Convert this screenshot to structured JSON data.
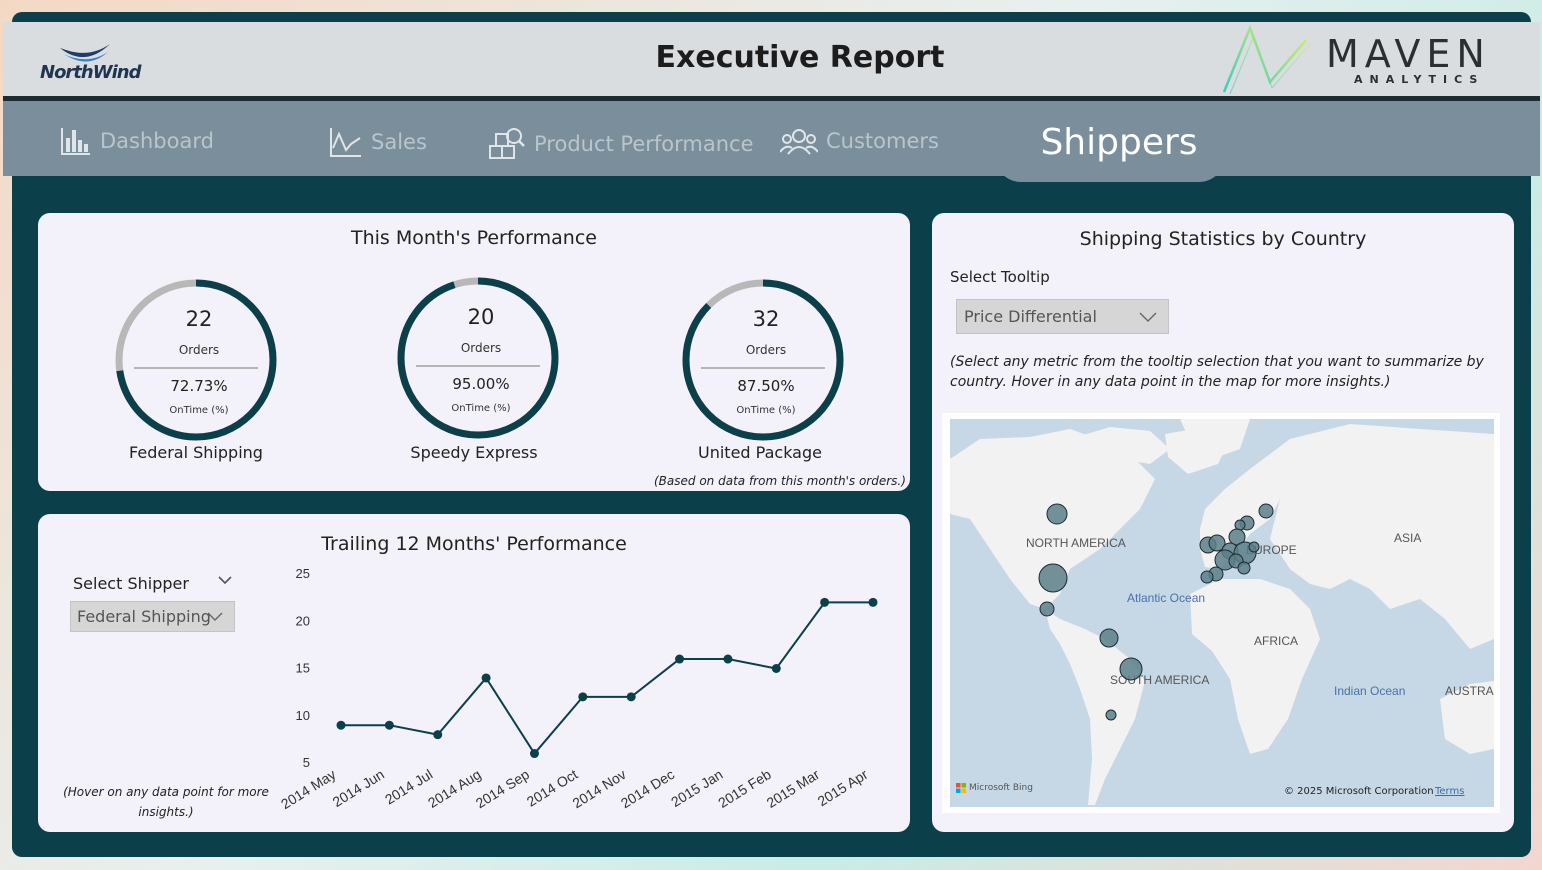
{
  "header": {
    "title": "Executive Report",
    "left_logo": "NorthWind",
    "right_logo": "MAVEN",
    "right_logo_sub": "ANALYTICS"
  },
  "nav": {
    "items": [
      {
        "label": "Dashboard",
        "icon": "bar-chart-icon"
      },
      {
        "label": "Sales",
        "icon": "line-chart-icon"
      },
      {
        "label": "Product Performance",
        "icon": "boxes-magnifier-icon"
      },
      {
        "label": "Customers",
        "icon": "people-icon"
      }
    ],
    "active": "Shippers"
  },
  "month_card": {
    "title": "This Month's Performance",
    "orders_label": "Orders",
    "ontime_label": "OnTime (%)",
    "footnote": "(Based on data from this month's orders.)",
    "shippers": [
      {
        "name": "Federal Shipping",
        "orders": "22",
        "ontime": "72.73%",
        "ontime_value": 0.7273
      },
      {
        "name": "Speedy Express",
        "orders": "20",
        "ontime": "95.00%",
        "ontime_value": 0.95
      },
      {
        "name": "United Package",
        "orders": "32",
        "ontime": "87.50%",
        "ontime_value": 0.875
      }
    ]
  },
  "trailing_card": {
    "title": "Trailing 12 Months' Performance",
    "select_label": "Select Shipper",
    "select_value": "Federal Shipping",
    "hover_note_1": "(Hover on any data point for more",
    "hover_note_2": "insights.)"
  },
  "chart_data": {
    "type": "line",
    "title": "Trailing 12 Months' Performance",
    "x": [
      "2014 May",
      "2014 Jun",
      "2014 Jul",
      "2014 Aug",
      "2014 Sep",
      "2014 Oct",
      "2014 Nov",
      "2014 Dec",
      "2015 Jan",
      "2015 Feb",
      "2015 Mar",
      "2015 Apr"
    ],
    "series": [
      {
        "values": [
          9,
          9,
          8,
          14,
          6,
          12,
          12,
          16,
          16,
          15,
          22,
          22
        ]
      }
    ],
    "yticks": [
      5,
      10,
      15,
      20,
      25
    ],
    "ylim": [
      5,
      25
    ],
    "grid": false,
    "color": "#0b3f49"
  },
  "map_card": {
    "title": "Shipping Statistics by Country",
    "tooltip_label": "Select Tooltip",
    "tooltip_value": "Price Differential",
    "instructions_1": "(Select any metric from the tooltip selection that you want to summarize by",
    "instructions_2": "country. Hover in any data point in the map for more insights.)",
    "labels": {
      "north_america": "NORTH AMERICA",
      "europe": "EUROPE",
      "asia": "ASIA",
      "atlantic": "Atlantic Ocean",
      "africa": "AFRICA",
      "south_america": "SOUTH AMERICA",
      "indian": "Indian Ocean",
      "australia": "AUSTRA"
    },
    "bing": "Microsoft Bing",
    "copyright": "© 2025 Microsoft Corporation",
    "terms": "Terms"
  },
  "colors": {
    "frame": "#0b3f49",
    "nav": "#7a8f9b",
    "card": "#f3f1f9",
    "accent": "#0b3f49",
    "gauge_bg": "#b8b8b8",
    "bubble": "#5c7f88",
    "water": "#c6d7e6"
  }
}
